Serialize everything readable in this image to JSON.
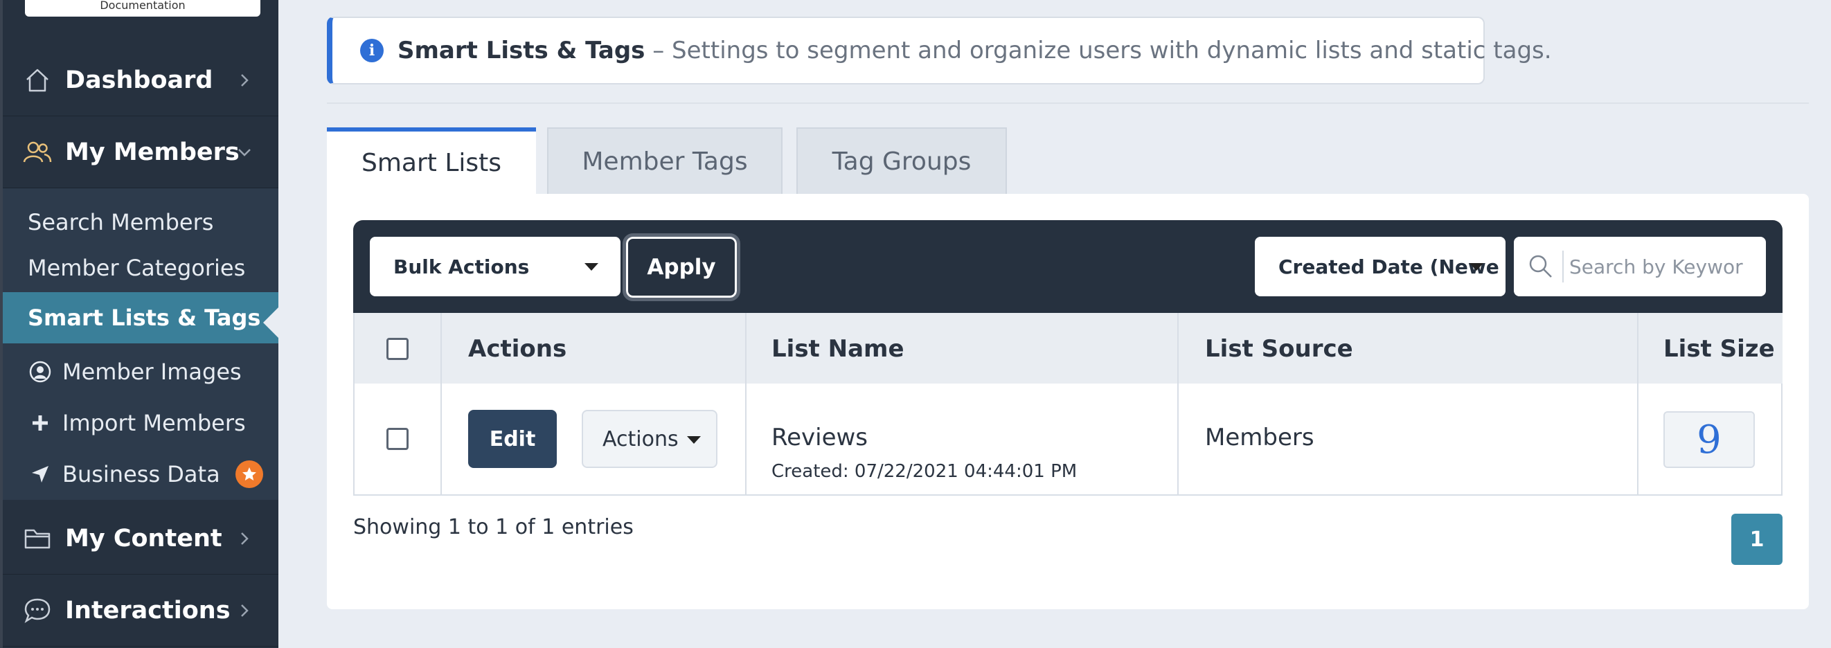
{
  "sidebar": {
    "documentation_label": "Documentation",
    "dashboard": "Dashboard",
    "my_members": "My Members",
    "sub_items": {
      "search_members": "Search Members",
      "member_categories": "Member Categories",
      "smart_lists_tags": "Smart Lists & Tags",
      "member_images": "Member Images",
      "import_members": "Import Members",
      "business_data": "Business Data"
    },
    "my_content": "My Content",
    "interactions": "Interactions",
    "accent_color": "#3a7f99",
    "badge_color": "#f07a2b"
  },
  "banner": {
    "title": "Smart Lists & Tags",
    "description": " – Settings to segment and organize users with dynamic lists and static tags."
  },
  "tabs": {
    "smart_lists": "Smart Lists",
    "member_tags": "Member Tags",
    "tag_groups": "Tag Groups"
  },
  "toolbar": {
    "bulk_actions": "Bulk Actions",
    "apply": "Apply",
    "sort": "Created Date (Newe",
    "search_placeholder": "Search by Keywor"
  },
  "table": {
    "headers": {
      "actions": "Actions",
      "list_name": "List Name",
      "list_source": "List Source",
      "list_size": "List Size"
    },
    "rows": [
      {
        "edit": "Edit",
        "actions": "Actions",
        "list_name": "Reviews",
        "created": "Created: 07/22/2021 04:44:01 PM",
        "list_source": "Members",
        "list_size": "9"
      }
    ]
  },
  "footer": {
    "showing": "Showing 1 to 1 of 1 entries",
    "page": "1"
  }
}
